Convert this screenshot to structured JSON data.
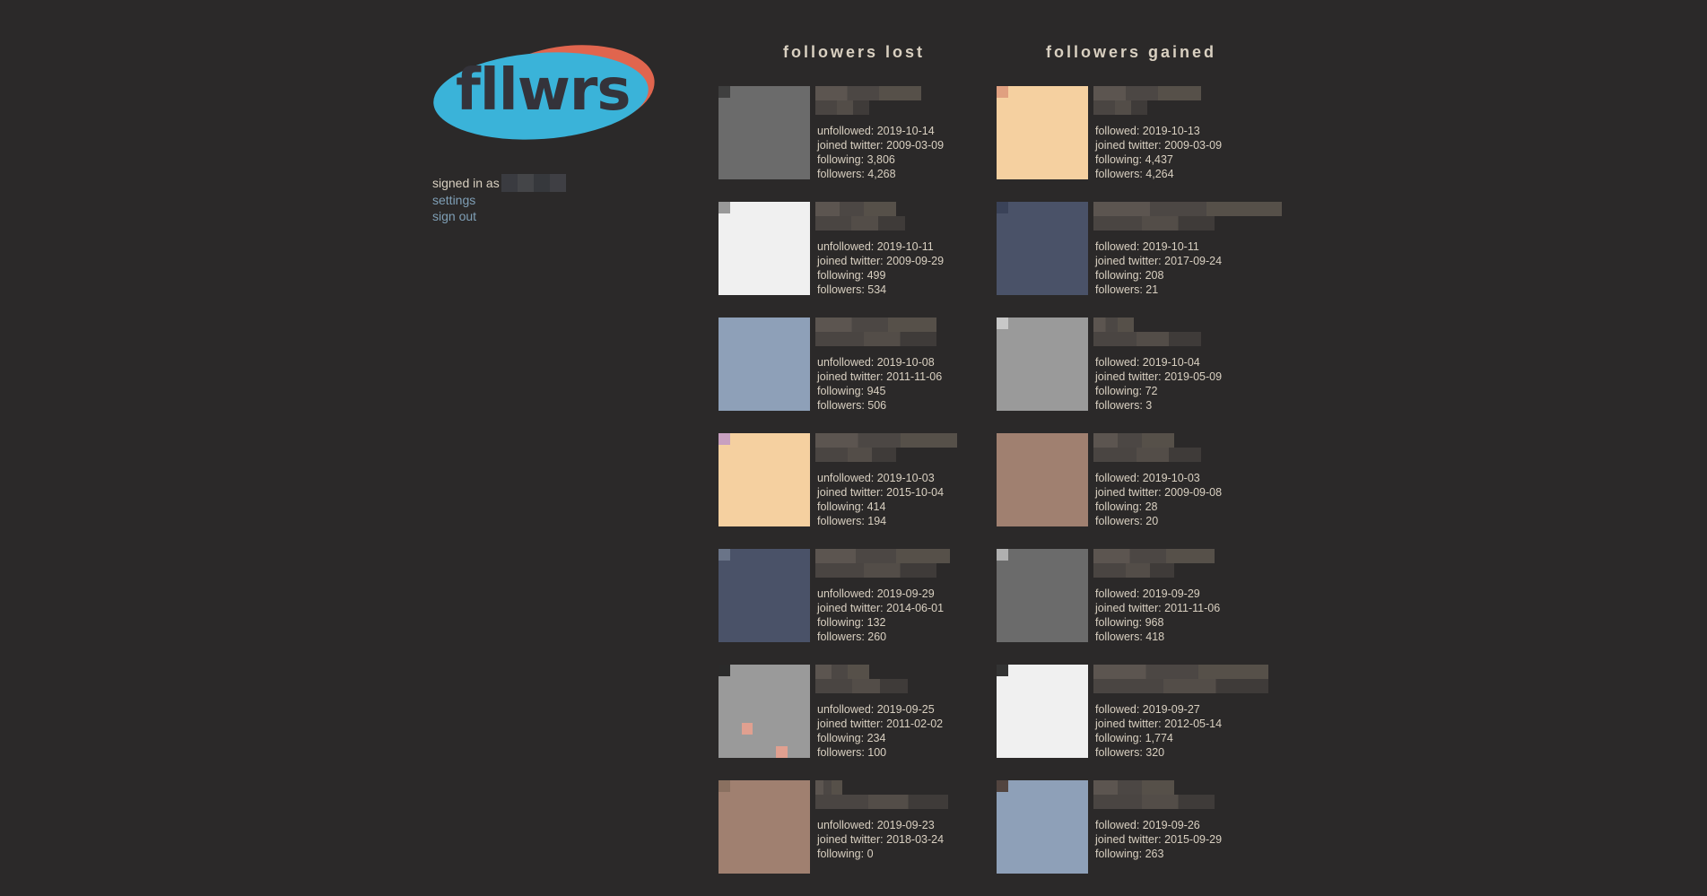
{
  "app": {
    "logo_text": "fllwrs"
  },
  "account": {
    "signed_in_label": "signed in as",
    "settings_label": "settings",
    "sign_out_label": "sign out"
  },
  "columns": {
    "lost_title": "followers lost",
    "gained_title": "followers gained"
  },
  "lost": [
    {
      "unfollowed": "unfollowed: 2019-10-14",
      "joined": "joined twitter: 2009-03-09",
      "following": "following: 3,806",
      "followers": "followers: 4,268"
    },
    {
      "unfollowed": "unfollowed: 2019-10-11",
      "joined": "joined twitter: 2009-09-29",
      "following": "following: 499",
      "followers": "followers: 534"
    },
    {
      "unfollowed": "unfollowed: 2019-10-08",
      "joined": "joined twitter: 2011-11-06",
      "following": "following: 945",
      "followers": "followers: 506"
    },
    {
      "unfollowed": "unfollowed: 2019-10-03",
      "joined": "joined twitter: 2015-10-04",
      "following": "following: 414",
      "followers": "followers: 194"
    },
    {
      "unfollowed": "unfollowed: 2019-09-29",
      "joined": "joined twitter: 2014-06-01",
      "following": "following: 132",
      "followers": "followers: 260"
    },
    {
      "unfollowed": "unfollowed: 2019-09-25",
      "joined": "joined twitter: 2011-02-02",
      "following": "following: 234",
      "followers": "followers: 100"
    },
    {
      "unfollowed": "unfollowed: 2019-09-23",
      "joined": "joined twitter: 2018-03-24",
      "following": "following: 0",
      "followers": ""
    }
  ],
  "gained": [
    {
      "followed": "followed: 2019-10-13",
      "joined": "joined twitter: 2009-03-09",
      "following": "following: 4,437",
      "followers": "followers: 4,264"
    },
    {
      "followed": "followed: 2019-10-11",
      "joined": "joined twitter: 2017-09-24",
      "following": "following: 208",
      "followers": "followers: 21"
    },
    {
      "followed": "followed: 2019-10-04",
      "joined": "joined twitter: 2019-05-09",
      "following": "following: 72",
      "followers": "followers: 3"
    },
    {
      "followed": "followed: 2019-10-03",
      "joined": "joined twitter: 2009-09-08",
      "following": "following: 28",
      "followers": "followers: 20"
    },
    {
      "followed": "followed: 2019-09-29",
      "joined": "joined twitter: 2011-11-06",
      "following": "following: 968",
      "followers": "followers: 418"
    },
    {
      "followed": "followed: 2019-09-27",
      "joined": "joined twitter: 2012-05-14",
      "following": "following: 1,774",
      "followers": "followers: 320"
    },
    {
      "followed": "followed: 2019-09-26",
      "joined": "joined twitter: 2015-09-29",
      "following": "following: 263",
      "followers": ""
    }
  ]
}
